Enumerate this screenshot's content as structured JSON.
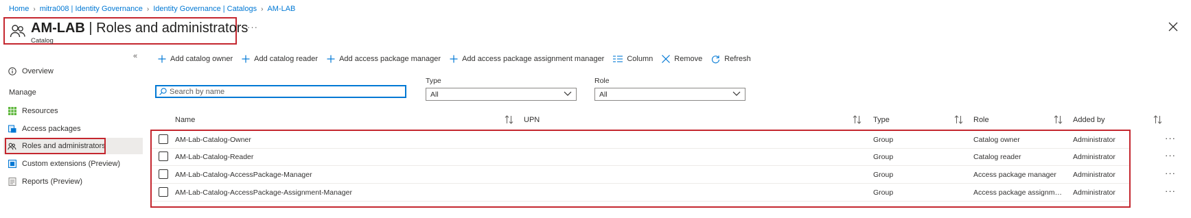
{
  "breadcrumb": [
    {
      "label": "Home"
    },
    {
      "label": "mitra008 | Identity Governance"
    },
    {
      "label": "Identity Governance | Catalogs"
    },
    {
      "label": "AM-LAB"
    }
  ],
  "header": {
    "title_bold": "AM-LAB",
    "title_rest": " | Roles and administrators",
    "subtitle": "Catalog",
    "more": "···",
    "title_icon": "people-icon",
    "close_icon": "close-icon"
  },
  "sidebar": {
    "collapse_icon": "«",
    "section_label": "Manage",
    "items": [
      {
        "label": "Overview",
        "icon": "info-icon"
      },
      {
        "label": "Resources",
        "icon": "grid-icon"
      },
      {
        "label": "Access packages",
        "icon": "package-icon"
      },
      {
        "label": "Roles and administrators",
        "icon": "people-icon",
        "selected": true
      },
      {
        "label": "Custom extensions (Preview)",
        "icon": "extension-icon"
      },
      {
        "label": "Reports (Preview)",
        "icon": "report-icon"
      }
    ]
  },
  "toolbar": {
    "add_catalog_owner": "Add catalog owner",
    "add_catalog_reader": "Add catalog reader",
    "add_access_package_manager": "Add access package manager",
    "add_access_package_assignment_manager": "Add access package assignment manager",
    "column": "Column",
    "remove": "Remove",
    "refresh": "Refresh"
  },
  "filters": {
    "search_placeholder": "Search by name",
    "search_value": "",
    "type_label": "Type",
    "type_value": "All",
    "role_label": "Role",
    "role_value": "All"
  },
  "table": {
    "columns": {
      "name": "Name",
      "upn": "UPN",
      "type": "Type",
      "role": "Role",
      "added_by": "Added by"
    },
    "rows": [
      {
        "name": "AM-Lab-Catalog-Owner",
        "upn": "",
        "type": "Group",
        "role": "Catalog owner",
        "added_by": "Administrator"
      },
      {
        "name": "AM-Lab-Catalog-Reader",
        "upn": "",
        "type": "Group",
        "role": "Catalog reader",
        "added_by": "Administrator"
      },
      {
        "name": "AM-Lab-Catalog-AccessPackage-Manager",
        "upn": "",
        "type": "Group",
        "role": "Access package manager",
        "added_by": "Administrator"
      },
      {
        "name": "AM-Lab-Catalog-AccessPackage-Assignment-Manager",
        "upn": "",
        "type": "Group",
        "role": "Access package assignment manager",
        "added_by": "Administrator"
      }
    ],
    "row_more": "···"
  },
  "colors": {
    "accent": "#0078d4",
    "highlight_outline": "#c4262e",
    "selected_bg": "#edebe9"
  }
}
